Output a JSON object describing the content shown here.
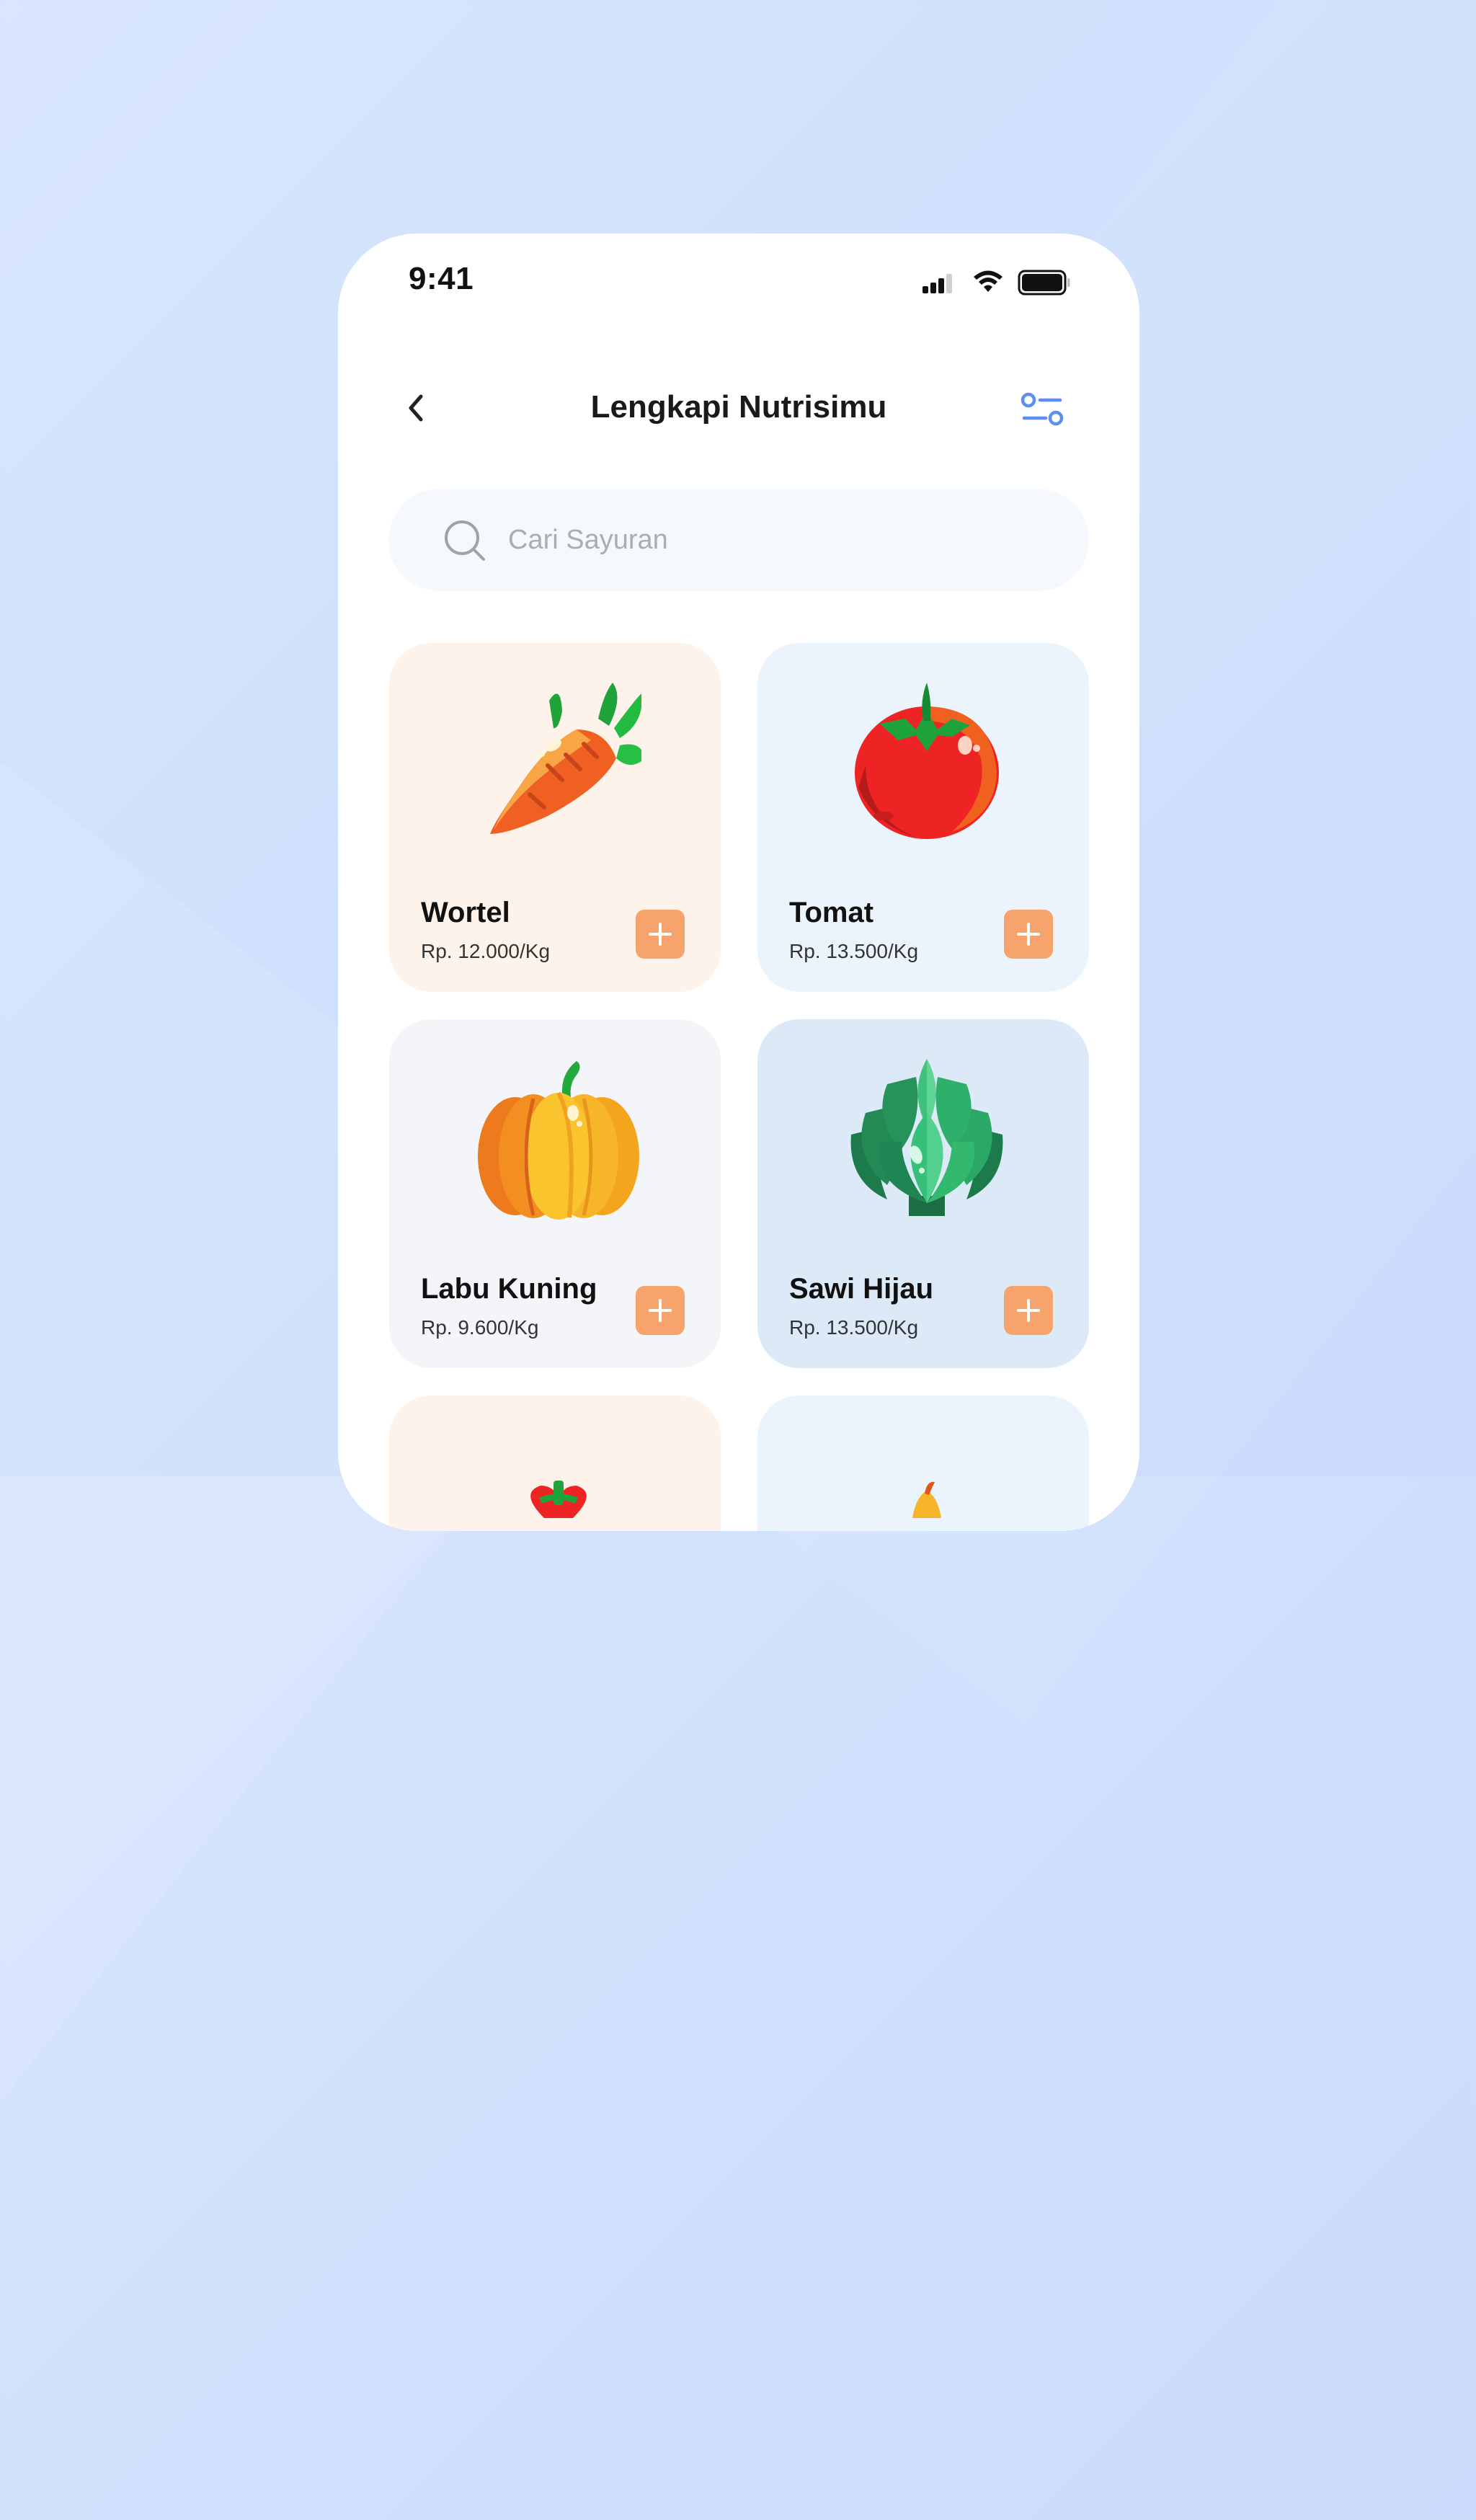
{
  "status_bar": {
    "time": "9:41"
  },
  "header": {
    "title": "Lengkapi Nutrisimu",
    "back_icon": "chevron-left-icon",
    "filter_icon": "filter-settings-icon"
  },
  "search": {
    "placeholder": "Cari Sayuran",
    "value": ""
  },
  "colors": {
    "accent": "#f6a46c",
    "filter_icon": "#5b8ff2",
    "card_orange": "#fdf3ea",
    "card_blue": "#ebf4fd",
    "card_gray": "#f3f5f8",
    "card_steel": "#dceaf7"
  },
  "products": [
    {
      "name": "Wortel",
      "price": "Rp. 12.000/Kg",
      "icon": "carrot-icon"
    },
    {
      "name": "Tomat",
      "price": "Rp. 13.500/Kg",
      "icon": "tomato-icon"
    },
    {
      "name": "Labu Kuning",
      "price": "Rp. 9.600/Kg",
      "icon": "pumpkin-icon"
    },
    {
      "name": "Sawi Hijau",
      "price": "Rp. 13.500/Kg",
      "icon": "artichoke-icon"
    }
  ]
}
